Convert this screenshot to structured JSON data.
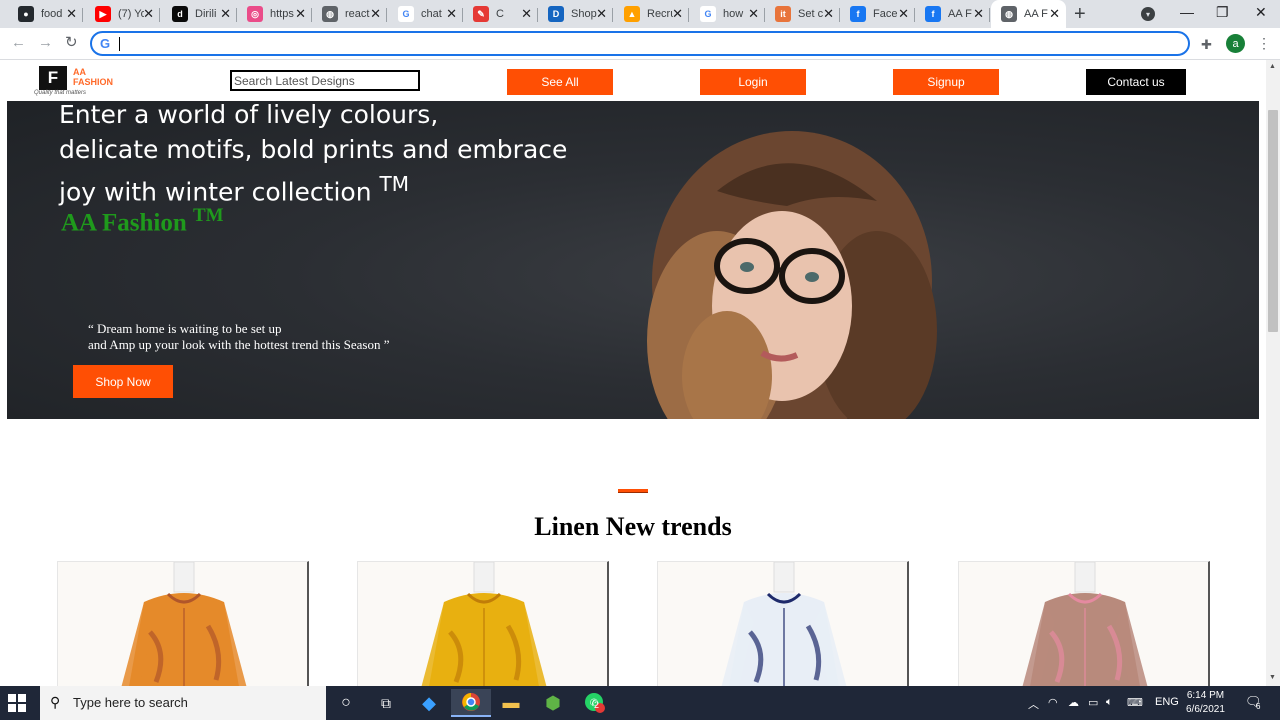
{
  "browser": {
    "tabs": [
      {
        "label": "food",
        "favicon": "github-icon",
        "color": "#24292e",
        "glyph": "●"
      },
      {
        "label": "(7) Yo",
        "favicon": "youtube-icon",
        "color": "#ff0000",
        "glyph": "▶"
      },
      {
        "label": "Dirili",
        "favicon": "dailymotion-icon",
        "color": "#0a0a0a",
        "glyph": "d"
      },
      {
        "label": "https",
        "favicon": "dribbble-icon",
        "color": "#ea4c89",
        "glyph": "◎"
      },
      {
        "label": "react",
        "favicon": "globe-icon",
        "color": "#5f6368",
        "glyph": "◍"
      },
      {
        "label": "chat",
        "favicon": "google-icon",
        "color": "#ffffff",
        "glyph": "G"
      },
      {
        "label": "C",
        "favicon": "thumbs-up-icon",
        "color": "#e53935",
        "glyph": "✎"
      },
      {
        "label": "Shop",
        "favicon": "d-logo-icon",
        "color": "#1565c0",
        "glyph": "D"
      },
      {
        "label": "Recru",
        "favicon": "firebase-icon",
        "color": "#ffa000",
        "glyph": "▲"
      },
      {
        "label": "how",
        "favicon": "google-icon",
        "color": "#ffffff",
        "glyph": "G"
      },
      {
        "label": "Set c",
        "favicon": "it-icon",
        "color": "#e8743b",
        "glyph": "it"
      },
      {
        "label": "Face",
        "favicon": "facebook-icon",
        "color": "#1877f2",
        "glyph": "f"
      },
      {
        "label": "AA F",
        "favicon": "facebook-icon",
        "color": "#1877f2",
        "glyph": "f"
      },
      {
        "label": "AA F",
        "favicon": "globe-icon",
        "color": "#5f6368",
        "glyph": "◍"
      }
    ],
    "address_value": "",
    "profile_initial": "a"
  },
  "site": {
    "logo": {
      "box": "F",
      "brand_line1": "AA",
      "brand_line2": "FASHION",
      "tagline": "Quality that matters"
    },
    "search_placeholder": "Search Latest Designs",
    "nav": {
      "see_all": "See All",
      "login": "Login",
      "signup": "Signup",
      "contact": "Contact us"
    },
    "hero": {
      "line1": "Enter a world of lively colours,",
      "line2": "delicate motifs, bold prints and embrace",
      "line3": "joy with winter collection",
      "tm": "TM",
      "brand": "AA Fashion",
      "quote1": "“ Dream home is waiting to be set up",
      "quote2": "and Amp up your look with the hottest trend this Season ”",
      "shop_now": "Shop Now"
    },
    "section_title": "Linen New trends",
    "products": [
      {
        "color": "#e58a2a",
        "accent": "#b0562a"
      },
      {
        "color": "#e8b010",
        "accent": "#c07d08"
      },
      {
        "color": "#e8eef6",
        "accent": "#1e2a6b"
      },
      {
        "color": "#b88a7c",
        "accent": "#e58aa0"
      }
    ]
  },
  "taskbar": {
    "search_text": "Type here to search",
    "lang": "ENG",
    "time": "6:14 PM",
    "date": "6/6/2021",
    "notif_count": "6",
    "whatsapp_badge": "2"
  }
}
